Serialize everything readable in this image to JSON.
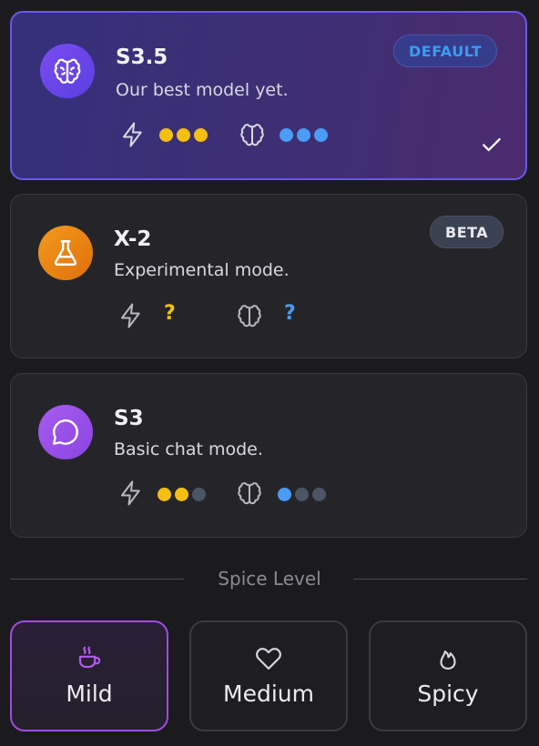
{
  "models": [
    {
      "name": "S3.5",
      "description": "Our best model yet.",
      "badge": "DEFAULT",
      "icon": "brain-icon",
      "speed_rating": 3,
      "intelligence_rating": 3,
      "selected": true
    },
    {
      "name": "X-2",
      "description": "Experimental mode.",
      "badge": "BETA",
      "icon": "flask-icon",
      "speed_rating": "?",
      "intelligence_rating": "?",
      "selected": false
    },
    {
      "name": "S3",
      "description": "Basic chat mode.",
      "badge": "",
      "icon": "chat-bubble-icon",
      "speed_rating": 2,
      "intelligence_rating": 1,
      "selected": false
    }
  ],
  "rating_max": 3,
  "spice": {
    "label": "Spice Level",
    "options": [
      {
        "label": "Mild",
        "icon": "coffee-cup-icon",
        "active": true
      },
      {
        "label": "Medium",
        "icon": "heart-icon",
        "active": false
      },
      {
        "label": "Spicy",
        "icon": "flame-icon",
        "active": false
      }
    ]
  },
  "colors": {
    "speed": "#f5bf0f",
    "intelligence": "#4a9cf5",
    "inactive_dot": "#4b5563",
    "default_badge_text": "#3b9cf2",
    "beta_badge_text": "#e8e8ee",
    "accent_purple": "#a04be4"
  }
}
